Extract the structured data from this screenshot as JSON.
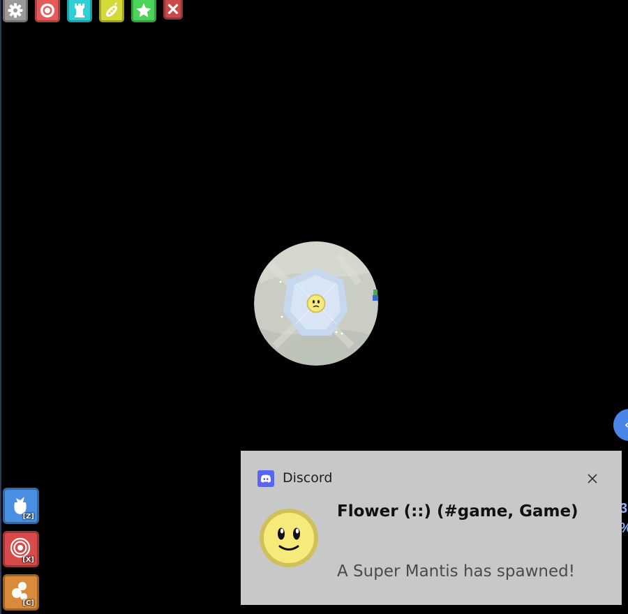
{
  "toolbar": {
    "buttons": [
      {
        "name": "settings",
        "icon": "gear-icon",
        "color": "#9a9a9a"
      },
      {
        "name": "target",
        "icon": "target-icon",
        "color": "#e65a5a"
      },
      {
        "name": "tower",
        "icon": "tower-icon",
        "color": "#2ed0d6"
      },
      {
        "name": "gallery",
        "icon": "pea-pod-icon",
        "color": "#d4d93a"
      },
      {
        "name": "favorite",
        "icon": "star-icon",
        "color": "#4cd45a"
      },
      {
        "name": "close",
        "icon": "close-icon",
        "color": "#c84a4a"
      }
    ]
  },
  "abilities": [
    {
      "key": "[Z]",
      "icon": "bag-icon",
      "color": "#4a90e2"
    },
    {
      "key": "[X]",
      "icon": "vortex-icon",
      "color": "#d94a4a"
    },
    {
      "key": "[C]",
      "icon": "bubbles-icon",
      "color": "#d98a3a"
    }
  ],
  "right_edge": {
    "circle_glyph": "«",
    "text_line_1": "3",
    "text_line_2": "%"
  },
  "notification": {
    "app_name": "Discord",
    "title": "Flower (::) (#game, Game)",
    "message": "A Super Mantis has spawned!"
  },
  "colors": {
    "background": "#000000",
    "toast_background": "#c8c8c8",
    "discord_blurple": "#5865f2",
    "flower_yellow": "#f5ea7a"
  }
}
